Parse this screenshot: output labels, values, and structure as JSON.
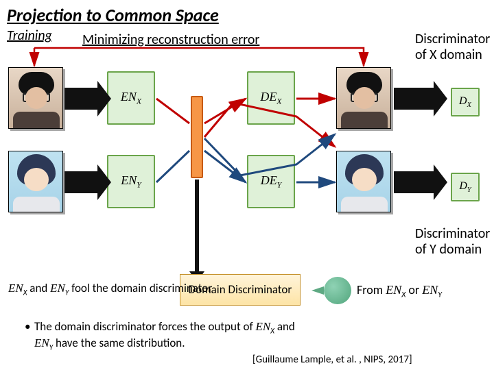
{
  "title": "Projection to Common Space",
  "subtitle": "Training",
  "subhead": "Minimizing reconstruction error",
  "labels": {
    "disc_x": "Discriminator of X domain",
    "disc_y": "Discriminator of Y domain"
  },
  "blocks": {
    "enx": "EN",
    "enx_sub": "X",
    "eny": "EN",
    "eny_sub": "Y",
    "dex": "DE",
    "dex_sub": "X",
    "dey": "DE",
    "dey_sub": "Y",
    "dx": "D",
    "dx_sub": "X",
    "dy": "D",
    "dy_sub": "Y"
  },
  "domain_disc": "Domain Discriminator",
  "from_text_prefix": "From ",
  "from_text_mid": " or ",
  "fool1": "EN",
  "fool2": " and ",
  "fool3": "EN",
  "fool_tail": " fool the domain discriminator",
  "force_line1_pre": "The domain discriminator forces the output of ",
  "force_line1_mid": " and",
  "force_line2_pre": "",
  "force_line2_tail": " have the same distribution.",
  "reference": "[Guillaume Lample, et al. , NIPS, 2017]"
}
